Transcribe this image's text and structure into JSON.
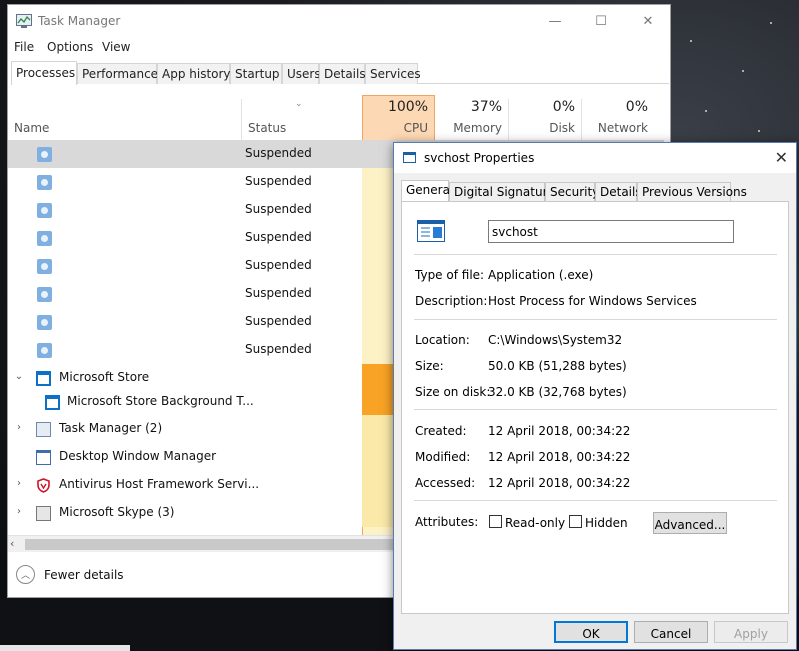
{
  "task_manager": {
    "title": "Task Manager",
    "window_controls": {
      "minimize": "—",
      "maximize": "☐",
      "close": "✕"
    },
    "menu": [
      "File",
      "Options",
      "View"
    ],
    "tabs": [
      "Processes",
      "Performance",
      "App history",
      "Startup",
      "Users",
      "Details",
      "Services"
    ],
    "active_tab": "Processes",
    "columns": {
      "name": "Name",
      "status": "Status",
      "cpu": {
        "pct": "100%",
        "label": "CPU"
      },
      "memory": {
        "pct": "37%",
        "label": "Memory"
      },
      "disk": {
        "pct": "0%",
        "label": "Disk"
      },
      "network": {
        "pct": "0%",
        "label": "Network"
      }
    },
    "rows": [
      {
        "name": "",
        "status": "Suspended",
        "icon": "gear-icon",
        "selected": true
      },
      {
        "name": "",
        "status": "Suspended",
        "icon": "gear-icon"
      },
      {
        "name": "",
        "status": "Suspended",
        "icon": "gear-icon"
      },
      {
        "name": "",
        "status": "Suspended",
        "icon": "gear-icon"
      },
      {
        "name": "",
        "status": "Suspended",
        "icon": "gear-icon"
      },
      {
        "name": "",
        "status": "Suspended",
        "icon": "gear-icon"
      },
      {
        "name": "",
        "status": "Suspended",
        "icon": "gear-icon"
      },
      {
        "name": "",
        "status": "Suspended",
        "icon": "gear-icon"
      },
      {
        "name": "Microsoft Store",
        "status": "",
        "icon": "store-icon",
        "expander": "expanded"
      },
      {
        "name": "Microsoft Store Background T...",
        "status": "",
        "icon": "store-icon",
        "child": true
      },
      {
        "name": "Task Manager (2)",
        "status": "",
        "icon": "task-manager-icon",
        "expander": "collapsed"
      },
      {
        "name": "Desktop Window Manager",
        "status": "",
        "icon": "window-icon"
      },
      {
        "name": "Antivirus Host Framework Servi...",
        "status": "",
        "icon": "shield-icon",
        "expander": "collapsed"
      },
      {
        "name": "Microsoft Skype (3)",
        "status": "",
        "icon": "skype-icon",
        "expander": "collapsed"
      }
    ],
    "fewer_details": "Fewer details"
  },
  "properties": {
    "title": "svchost Properties",
    "tabs": [
      "General",
      "Digital Signatures",
      "Security",
      "Details",
      "Previous Versions"
    ],
    "active_tab": "General",
    "filename": "svchost",
    "fields": {
      "type_label": "Type of file:",
      "type_value": "Application (.exe)",
      "desc_label": "Description:",
      "desc_value": "Host Process for Windows Services",
      "location_label": "Location:",
      "location_value": "C:\\Windows\\System32",
      "size_label": "Size:",
      "size_value": "50.0 KB (51,288 bytes)",
      "size_on_disk_label": "Size on disk:",
      "size_on_disk_value": "32.0 KB (32,768 bytes)",
      "created_label": "Created:",
      "created_value": "12 April 2018, 00:34:22",
      "modified_label": "Modified:",
      "modified_value": "12 April 2018, 00:34:22",
      "accessed_label": "Accessed:",
      "accessed_value": "12 April 2018, 00:34:22",
      "attributes_label": "Attributes:"
    },
    "readonly_label": "Read-only",
    "hidden_label": "Hidden",
    "advanced_label": "Advanced...",
    "buttons": {
      "ok": "OK",
      "cancel": "Cancel",
      "apply": "Apply"
    },
    "close_glyph": "✕"
  },
  "colors": {
    "cpu_header": "#fcd8b4",
    "cpu_hot": "#f8a325",
    "cpu_warm": "#fbe9a9",
    "accent_blue": "#0078d7"
  }
}
